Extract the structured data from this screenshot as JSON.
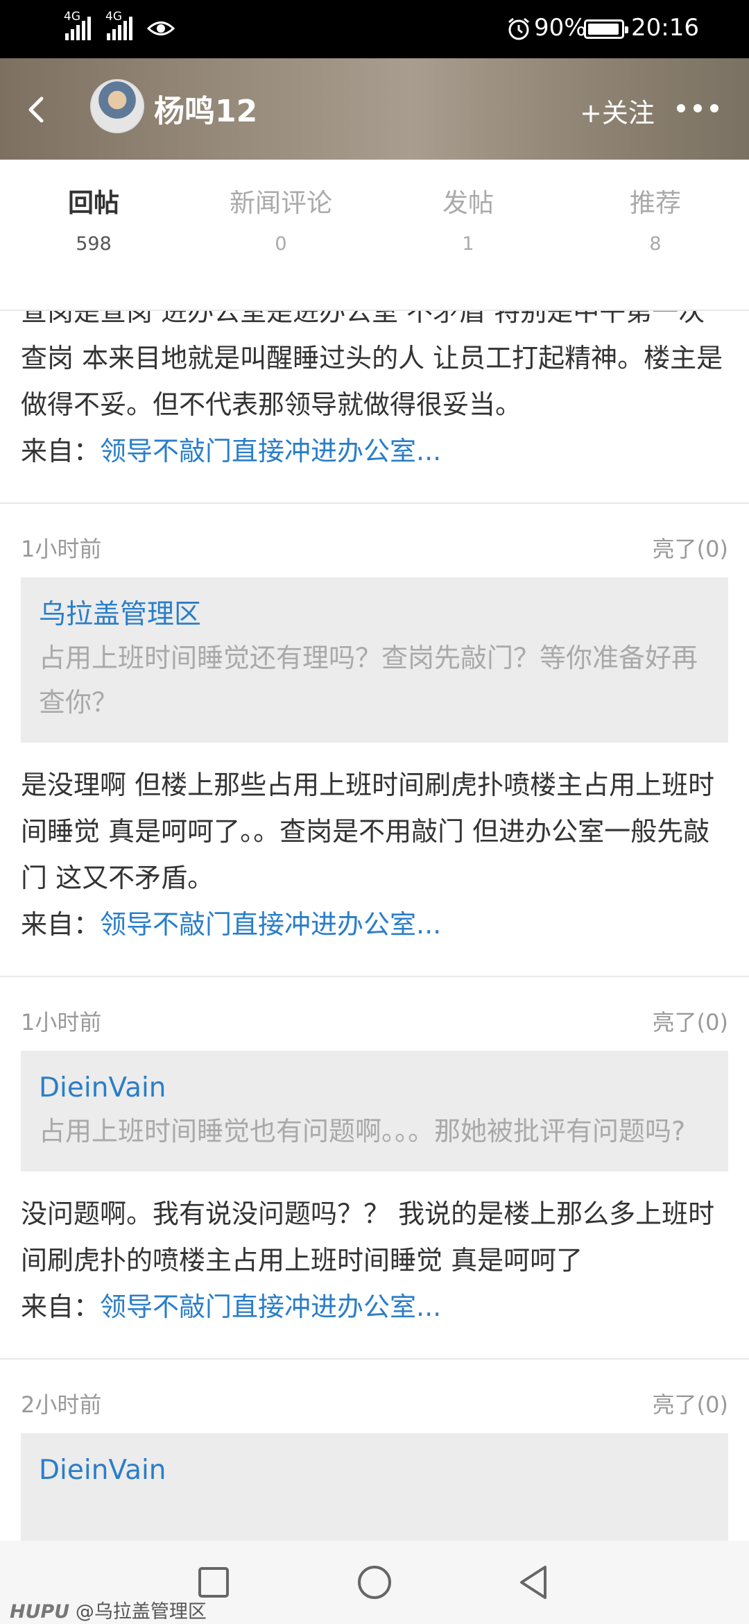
{
  "status_bar": {
    "signal1": "4G",
    "signal2": "4G",
    "battery_percent": "90%",
    "time": "20:16",
    "icons": [
      "signal-icon",
      "signal-icon",
      "eye-icon",
      "alarm-icon",
      "battery-icon"
    ]
  },
  "header": {
    "back_icon": "chevron-left-icon",
    "user_name": "杨鸣12",
    "follow_label": "+关注",
    "more_icon": "more-dots-icon"
  },
  "tabs": [
    {
      "label": "回帖",
      "count": "598",
      "active": true
    },
    {
      "label": "新闻评论",
      "count": "0",
      "active": false
    },
    {
      "label": "发帖",
      "count": "1",
      "active": false
    },
    {
      "label": "推荐",
      "count": "8",
      "active": false
    }
  ],
  "posts": [
    {
      "text": "查岗是查岗 进办公室是进办公室 不矛盾 特别是中午第一次查岗 本来目地就是叫醒睡过头的人 让员工打起精神。楼主是做得不妥。但不代表那领导就做得很妥当。",
      "source_label": "来自：",
      "source_link": "领导不敲门直接冲进办公室..."
    },
    {
      "time": "1小时前",
      "like": "亮了(0)",
      "quote_user": "乌拉盖管理区",
      "quote_text": "占用上班时间睡觉还有理吗？查岗先敲门？等你准备好再查你？",
      "text": "是没理啊 但楼上那些占用上班时间刷虎扑喷楼主占用上班时间睡觉 真是呵呵了。。查岗是不用敲门 但进办公室一般先敲门 这又不矛盾。",
      "source_label": "来自：",
      "source_link": "领导不敲门直接冲进办公室..."
    },
    {
      "time": "1小时前",
      "like": "亮了(0)",
      "quote_user": "DieinVain",
      "quote_text": "占用上班时间睡觉也有问题啊。。。那她被批评有问题吗?",
      "text": "没问题啊。我有说没问题吗？？ 我说的是楼上那么多上班时间刷虎扑的喷楼主占用上班时间睡觉 真是呵呵了",
      "source_label": "来自：",
      "source_link": "领导不敲门直接冲进办公室..."
    },
    {
      "time": "2小时前",
      "like": "亮了(0)",
      "quote_user": "DieinVain"
    }
  ],
  "nav_bar": {
    "recents_icon": "square-icon",
    "home_icon": "circle-icon",
    "back_icon": "triangle-back-icon",
    "watermark_brand": "HUPU",
    "watermark_text": "@乌拉盖管理区"
  }
}
